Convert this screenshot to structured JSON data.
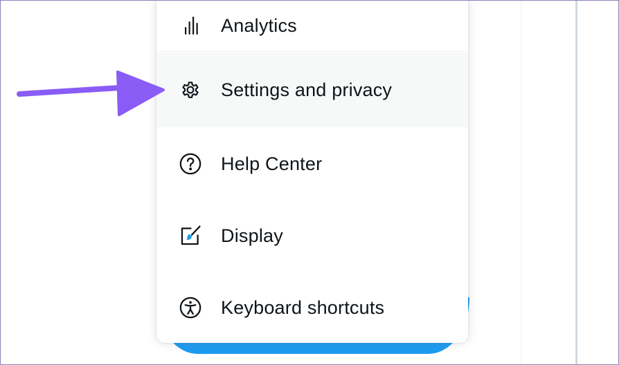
{
  "menu": {
    "items": [
      {
        "label": "Analytics",
        "icon": "analytics-bars-icon"
      },
      {
        "label": "Settings and privacy",
        "icon": "gear-icon"
      },
      {
        "label": "Help Center",
        "icon": "question-circle-icon"
      },
      {
        "label": "Display",
        "icon": "display-brush-icon"
      },
      {
        "label": "Keyboard shortcuts",
        "icon": "accessibility-icon"
      }
    ]
  },
  "colors": {
    "arrow": "#8a5cf6",
    "tweet_button": "#1d9bf0",
    "hover_background": "#f7f9f9",
    "text": "#0f1419",
    "display_brush": "#1d9bf0"
  }
}
